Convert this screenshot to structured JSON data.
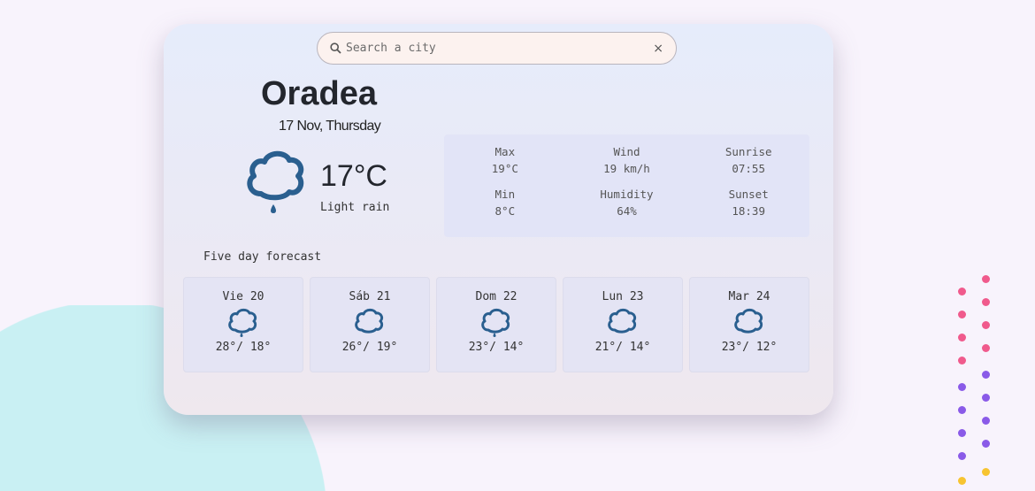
{
  "search": {
    "placeholder": "Search a city",
    "clear_label": "×"
  },
  "current": {
    "city": "Oradea",
    "date": "17 Nov, Thursday",
    "temperature": "17°C",
    "description": "Light rain",
    "icon": "cloud-rain-icon"
  },
  "stats": [
    {
      "label": "Max",
      "value": "19°C"
    },
    {
      "label": "Wind",
      "value": "19 km/h"
    },
    {
      "label": "Sunrise",
      "value": "07:55"
    },
    {
      "label": "Min",
      "value": "8°C"
    },
    {
      "label": "Humidity",
      "value": "64%"
    },
    {
      "label": "Sunset",
      "value": "18:39"
    }
  ],
  "forecast_title": "Five day forecast",
  "forecast": [
    {
      "day": "Vie 20",
      "temps": "28°/ 18°",
      "icon": "cloud-rain-icon"
    },
    {
      "day": "Sáb 21",
      "temps": "26°/ 19°",
      "icon": "cloud-icon"
    },
    {
      "day": "Dom 22",
      "temps": "23°/ 14°",
      "icon": "cloud-rain-icon"
    },
    {
      "day": "Lun 23",
      "temps": "21°/ 14°",
      "icon": "cloud-icon"
    },
    {
      "day": "Mar 24",
      "temps": "23°/ 12°",
      "icon": "cloud-icon"
    }
  ],
  "colors": {
    "icon": "#2a5f8f",
    "pink": "#f05a8c",
    "purple": "#8a5ae8",
    "yellow": "#f7c431"
  }
}
